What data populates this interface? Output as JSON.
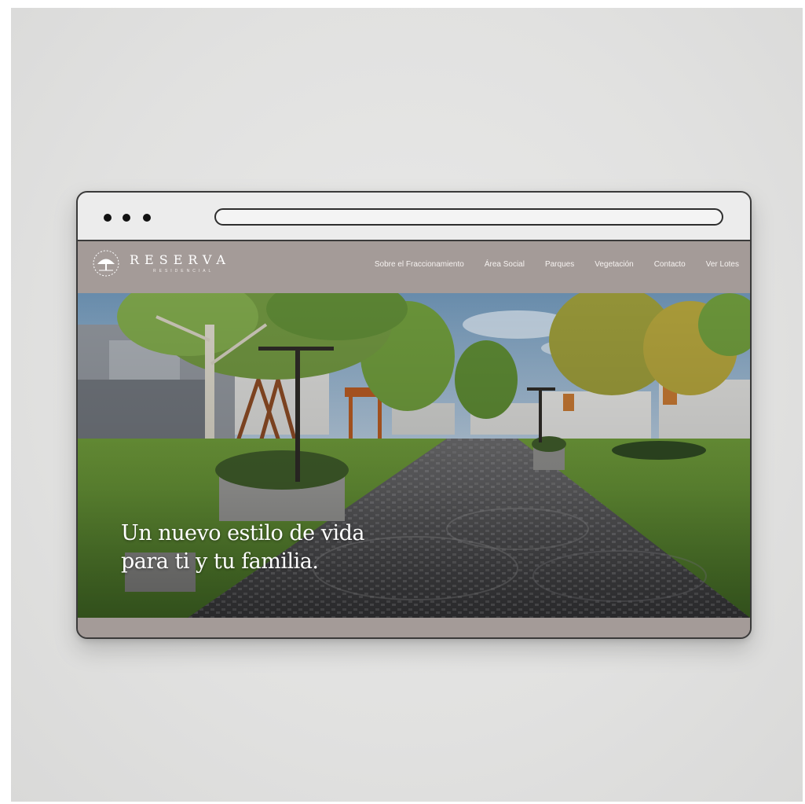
{
  "window": {
    "controls": [
      "dot-icon",
      "dot-icon",
      "dot-icon"
    ]
  },
  "site": {
    "brand": {
      "name": "RESERVA",
      "tagline": "RESIDENCIAL",
      "logo_icon": "tree-logo-icon"
    },
    "nav": [
      {
        "label": "Sobre el Fraccionamiento"
      },
      {
        "label": "Área Social"
      },
      {
        "label": "Parques"
      },
      {
        "label": "Vegetación"
      },
      {
        "label": "Contacto"
      },
      {
        "label": "Ver Lotes"
      }
    ]
  },
  "hero": {
    "headline_line1": "Un nuevo estilo de vida",
    "headline_line2": "para ti y tu familia."
  },
  "colors": {
    "nav_background": "#a49b98",
    "chrome": "#ececec",
    "page_background": "#e3e3e2"
  }
}
